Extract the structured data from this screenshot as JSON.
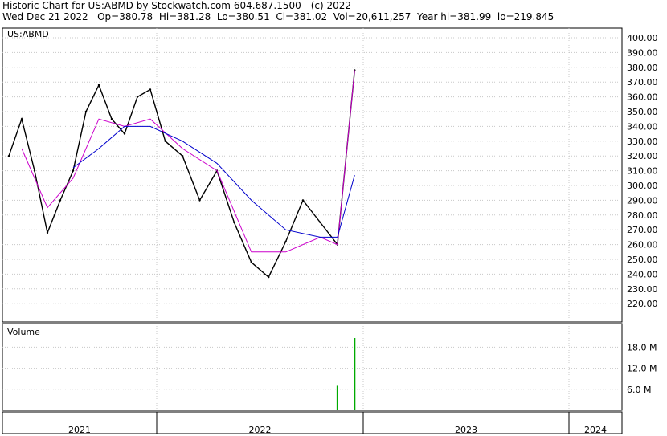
{
  "header": {
    "line1": "Historic Chart for US:ABMD by Stockwatch.com 604.687.1500 - (c) 2022",
    "line2": "Wed Dec 21 2022   Op=380.78  Hi=381.28  Lo=380.51  Cl=381.02  Vol=20,611,257  Year hi=381.99  lo=219.845"
  },
  "chart_data": [
    {
      "type": "line",
      "title": "US:ABMD",
      "ylim": [
        210,
        405
      ],
      "y_ticks": [
        "400.00",
        "390.00",
        "380.00",
        "370.00",
        "360.00",
        "350.00",
        "340.00",
        "330.00",
        "320.00",
        "310.00",
        "300.00",
        "290.00",
        "280.00",
        "270.00",
        "260.00",
        "250.00",
        "240.00",
        "230.00",
        "220.00"
      ],
      "x_ticks": [
        "2021",
        "2022",
        "2023",
        "2024"
      ],
      "grid": true,
      "series": [
        {
          "style": "price-bars",
          "color": "#000000",
          "x": [
            "2021-01",
            "2021-02",
            "2021-03",
            "2021-04",
            "2021-05",
            "2021-06",
            "2021-07",
            "2021-08",
            "2021-09",
            "2021-10",
            "2021-11",
            "2021-12",
            "2022-01",
            "2022-02",
            "2022-03",
            "2022-04",
            "2022-05",
            "2022-06",
            "2022-07",
            "2022-08",
            "2022-09",
            "2022-10",
            "2022-11",
            "2022-12"
          ],
          "values": [
            320,
            345,
            310,
            268,
            290,
            310,
            350,
            368,
            345,
            335,
            360,
            365,
            330,
            320,
            290,
            310,
            275,
            248,
            238,
            262,
            290,
            275,
            260,
            378
          ]
        },
        {
          "style": "moving-average",
          "color": "#cc00cc",
          "x": [
            "2021-02",
            "2021-04",
            "2021-06",
            "2021-08",
            "2021-10",
            "2021-12",
            "2022-02",
            "2022-04",
            "2022-06",
            "2022-08",
            "2022-10",
            "2022-11",
            "2022-12"
          ],
          "values": [
            325,
            285,
            305,
            345,
            340,
            345,
            325,
            310,
            255,
            255,
            265,
            260,
            378
          ]
        },
        {
          "style": "moving-average",
          "color": "#0000cc",
          "x": [
            "2021-06",
            "2021-08",
            "2021-10",
            "2021-12",
            "2022-02",
            "2022-04",
            "2022-06",
            "2022-08",
            "2022-10",
            "2022-11",
            "2022-12"
          ],
          "values": [
            312,
            325,
            340,
            340,
            330,
            315,
            290,
            270,
            265,
            265,
            307
          ]
        }
      ]
    },
    {
      "type": "bar",
      "title": "Volume",
      "ylim": [
        0,
        21000000
      ],
      "y_ticks": [
        "18.0 M",
        "12.0 M",
        "6.0 M"
      ],
      "grid": true,
      "x": [
        "2022-11",
        "2022-12"
      ],
      "values": [
        7000000,
        20611257
      ]
    }
  ]
}
